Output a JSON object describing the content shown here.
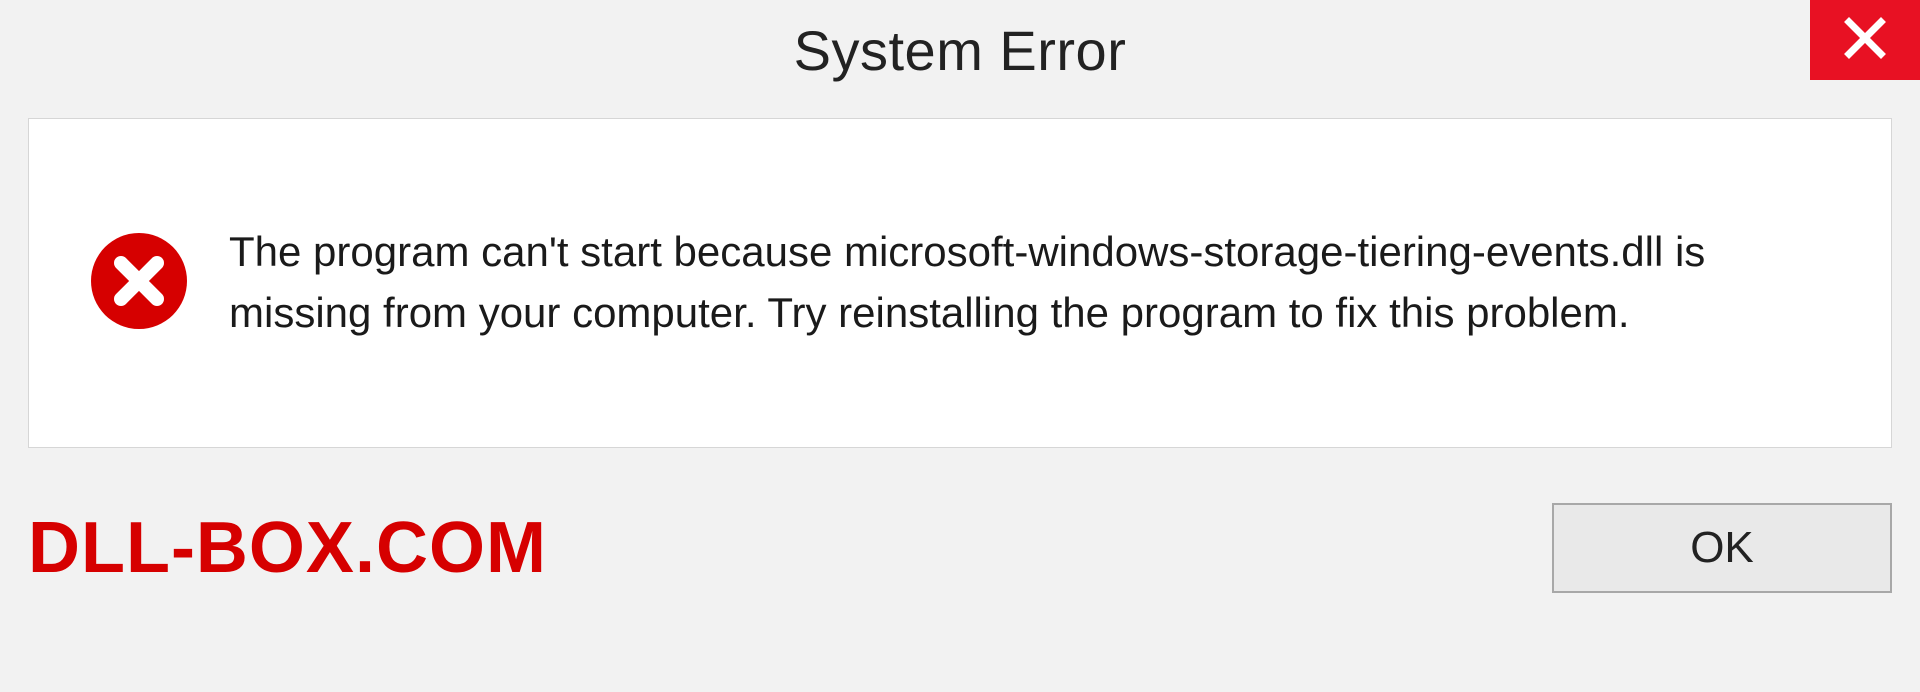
{
  "title": "System Error",
  "message": "The program can't start because microsoft-windows-storage-tiering-events.dll is missing from your computer. Try reinstalling the program to fix this problem.",
  "brand": "DLL-BOX.COM",
  "buttons": {
    "ok_label": "OK"
  },
  "colors": {
    "close_bg": "#e81123",
    "error_icon": "#d60000",
    "brand_text": "#d60000"
  },
  "icons": {
    "close": "close-icon",
    "error": "error-circle-icon"
  }
}
